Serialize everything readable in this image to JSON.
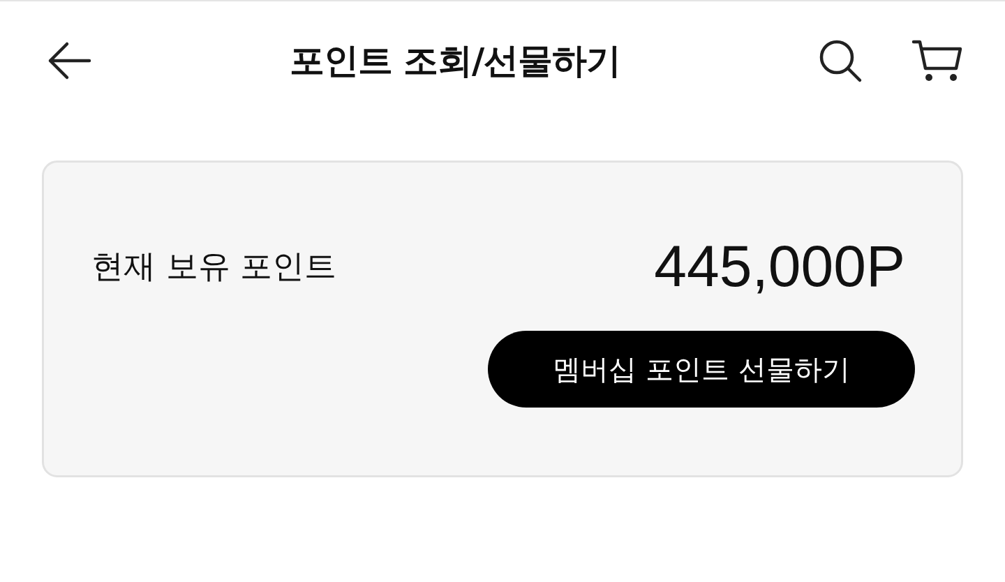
{
  "header": {
    "title": "포인트 조회/선물하기"
  },
  "points_card": {
    "label": "현재 보유 포인트",
    "value": "445,000P",
    "gift_button": "멤버십 포인트 선물하기"
  }
}
